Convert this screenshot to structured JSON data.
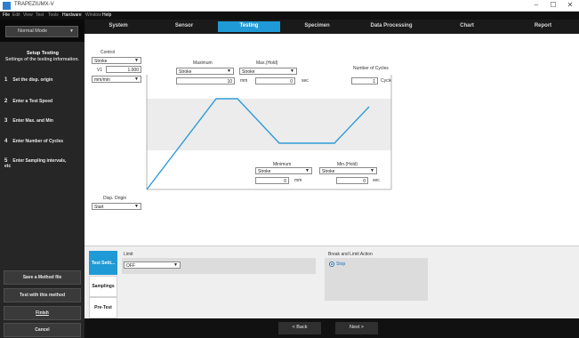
{
  "window": {
    "title": "TRAPEZIUMX-V",
    "controls": [
      "–",
      "☐",
      "✕"
    ]
  },
  "menu": [
    "File",
    "Edit",
    "View",
    "Test",
    "Tools",
    "Hardware",
    "Window",
    "Help"
  ],
  "mode": {
    "selected": "Normal Mode"
  },
  "tabs": [
    "System",
    "Sensor",
    "Testing",
    "Specimen",
    "Data Processing",
    "Chart",
    "Report"
  ],
  "active_tab": "Testing",
  "sidebar": {
    "heading": "Setup Testing",
    "subheading": "Settings of the testing information.",
    "steps": [
      {
        "num": "1",
        "label": "Set the disp. origin"
      },
      {
        "num": "2",
        "label": "Enter a Test Speed"
      },
      {
        "num": "3",
        "label": "Enter Max. and Min"
      },
      {
        "num": "4",
        "label": "Enter Number of Cycles"
      },
      {
        "num": "5",
        "label": "Enter Sampling intervals, etc"
      }
    ],
    "buttons": {
      "save": "Save a Method file",
      "test": "Test with this method",
      "finish": "Finish",
      "cancel": "Cancel"
    }
  },
  "control": {
    "label": "Control",
    "mode": "Stroke",
    "v1_label": "V1",
    "v1_value": "1.000",
    "unit": "mm/min"
  },
  "maximum": {
    "label": "Maximum",
    "type": "Stroke",
    "value": "10",
    "unit": "mm"
  },
  "max_hold": {
    "label": "Max.(Hold)",
    "type": "Stroke",
    "value": "0",
    "unit": "sec"
  },
  "cycles": {
    "label": "Number of Cycles",
    "value": "1",
    "unit": "Cycle"
  },
  "minimum": {
    "label": "Minimum",
    "type": "Stroke",
    "value": "0",
    "unit": "mm"
  },
  "min_hold": {
    "label": "Min.(Hold)",
    "type": "Stroke",
    "value": "0",
    "unit": "sec"
  },
  "disp_origin": {
    "label": "Disp. Origin",
    "value": "Start"
  },
  "bottom": {
    "vtabs": [
      "Test Setti...",
      "Samplings",
      "Pre-Test"
    ],
    "limit_label": "Limit",
    "limit_value": "OFF",
    "break_label": "Break and Limit Action",
    "break_option": "Stop"
  },
  "footer": {
    "back": "< Back",
    "next": "Next >"
  },
  "colors": {
    "accent": "#1f9ad6",
    "waveform": "#2f9bd8"
  }
}
